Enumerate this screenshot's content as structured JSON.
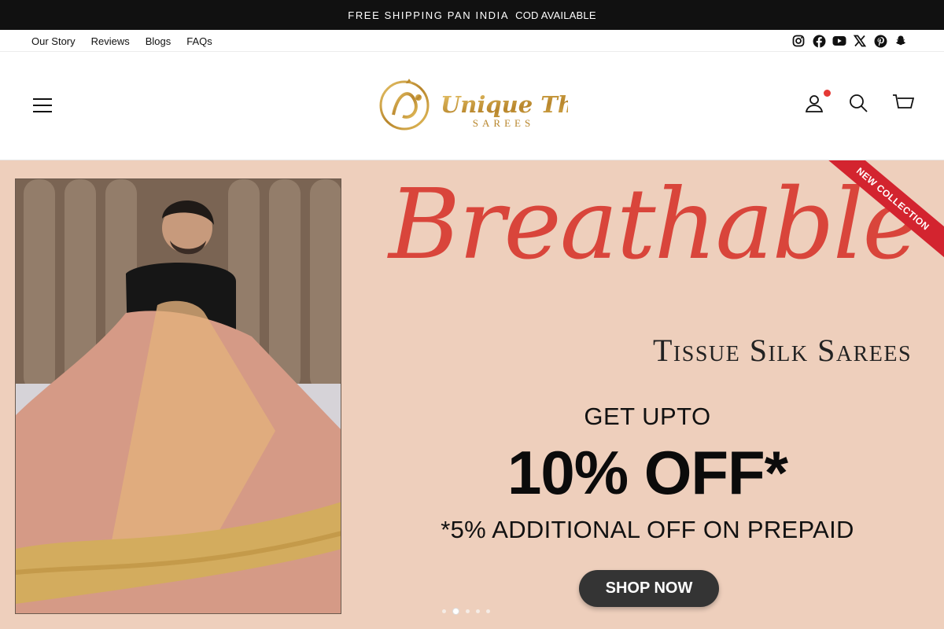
{
  "announcement": {
    "shipping": "FREE SHIPPING PAN INDIA",
    "cod": "COD AVAILABLE"
  },
  "topnav": {
    "links": [
      "Our Story",
      "Reviews",
      "Blogs",
      "FAQs"
    ]
  },
  "social": [
    "instagram-icon",
    "facebook-icon",
    "youtube-icon",
    "x-icon",
    "pinterest-icon",
    "snapchat-icon"
  ],
  "logo": {
    "brand": "Unique Threads",
    "tag": "SAREES"
  },
  "header_icons": [
    "account-icon",
    "search-icon",
    "cart-icon"
  ],
  "hero": {
    "script": "Breathable",
    "subtitle": "Tissue Silk Sarees",
    "get_upto": "GET UPTO",
    "discount": "10% OFF*",
    "prepaid": "*5% ADDITIONAL OFF ON PREPAID",
    "cta": "SHOP NOW",
    "ribbon": "NEW COLLECTION",
    "slides": 5,
    "active_slide": 2
  },
  "colors": {
    "announce_bg": "#111111",
    "hero_bg": "#eecfbc",
    "script": "#d9453b",
    "ribbon": "#d3242f",
    "button": "#343434",
    "badge": "#e53935"
  }
}
